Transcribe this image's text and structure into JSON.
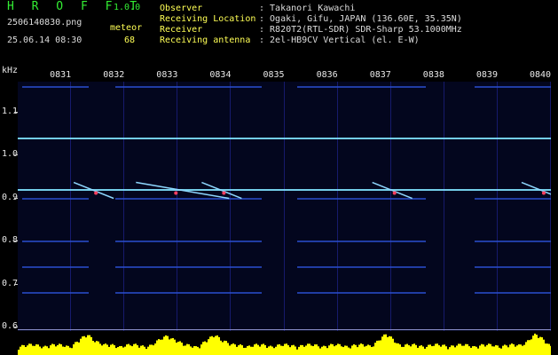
{
  "header": {
    "app_name": "H R O F F T",
    "version": "1.0.0",
    "filename": "2506140830.png",
    "mode_label": "meteor",
    "datetime": "25.06.14 08:30",
    "count": "68",
    "info": [
      {
        "label": "Observer",
        "value": ": Takanori Kawachi"
      },
      {
        "label": "Receiving Location",
        "value": ": Ogaki, Gifu, JAPAN (136.60E, 35.35N)"
      },
      {
        "label": "Receiver",
        "value": ": R820T2(RTL-SDR) SDR-Sharp 53.1000MHz"
      },
      {
        "label": "Receiving antenna",
        "value": ": 2el-HB9CV Vertical (el. E-W)"
      }
    ]
  },
  "chart_data": {
    "type": "heatmap",
    "ylabel": "kHz",
    "x_ticks": [
      "0831",
      "0832",
      "0833",
      "0834",
      "0835",
      "0836",
      "0837",
      "0838",
      "0839",
      "0840"
    ],
    "y_ticks": [
      "1.1",
      "1.0",
      "0.9",
      "0.8",
      "0.7",
      "0.6"
    ],
    "ylim": [
      0.59,
      1.17
    ],
    "carrier_lines_khz": [
      1.16,
      1.04,
      0.92,
      0.9,
      0.8,
      0.74,
      0.68
    ],
    "meteor_echo_minutes": [
      1.3,
      2.8,
      3.7,
      6.9,
      9.7
    ]
  },
  "colors": {
    "logo": "#33ee33",
    "label": "#ffff55",
    "background": "#000000",
    "spectrum_bg": "#03061e",
    "signal": "#7fe3ff",
    "level": "#ffff00"
  }
}
